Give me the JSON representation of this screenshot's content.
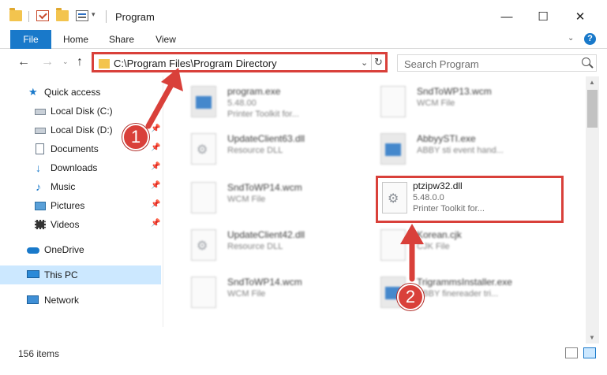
{
  "window": {
    "title": "Program",
    "minimize": "—",
    "maximize": "☐",
    "close": "✕"
  },
  "ribbon": {
    "tabs": [
      "File",
      "Home",
      "Share",
      "View"
    ],
    "help": "?"
  },
  "address": {
    "path": "C:\\Program Files\\Program Directory",
    "dropdown": "⌄",
    "refresh": "↻"
  },
  "search": {
    "placeholder": "Search Program"
  },
  "nav": {
    "back": "←",
    "forward": "→",
    "dropdown": "⌄",
    "up": "↑",
    "items": [
      {
        "label": "Quick access",
        "icon": "star-icon",
        "pinned": false
      },
      {
        "label": "Local Disk (C:)",
        "icon": "disk-icon",
        "pinned": false
      },
      {
        "label": "Local Disk (D:)",
        "icon": "disk-icon",
        "pinned": true
      },
      {
        "label": "Documents",
        "icon": "documents-icon",
        "pinned": true
      },
      {
        "label": "Downloads",
        "icon": "download-icon",
        "pinned": true
      },
      {
        "label": "Music",
        "icon": "music-icon",
        "pinned": true
      },
      {
        "label": "Pictures",
        "icon": "pictures-icon",
        "pinned": true
      },
      {
        "label": "Videos",
        "icon": "videos-icon",
        "pinned": true
      },
      {
        "label": "OneDrive",
        "icon": "cloud-icon",
        "pinned": false
      },
      {
        "label": "This PC",
        "icon": "computer-icon",
        "pinned": false,
        "selected": true
      },
      {
        "label": "Network",
        "icon": "network-icon",
        "pinned": false
      }
    ]
  },
  "files": [
    {
      "name": "program.exe",
      "line1": "5.48.00",
      "line2": "Printer Toolkit for...",
      "icon": "app"
    },
    {
      "name": "SndToWP13.wcm",
      "line1": "WCM File",
      "line2": "",
      "icon": "doc"
    },
    {
      "name": "UpdateClient63.dll",
      "line1": "Resource DLL",
      "line2": "",
      "icon": "gear"
    },
    {
      "name": "AbbyySTI.exe",
      "line1": "ABBY sti event hand...",
      "line2": "",
      "icon": "app"
    },
    {
      "name": "SndToWP14.wcm",
      "line1": "WCM File",
      "line2": "",
      "icon": "doc"
    },
    {
      "name": "ptzipw32.dll",
      "line1": "5.48.0.0",
      "line2": "Printer Toolkit for...",
      "icon": "gear",
      "highlighted": true
    },
    {
      "name": "UpdateClient42.dll",
      "line1": "Resource DLL",
      "line2": "",
      "icon": "gear"
    },
    {
      "name": "Korean.cjk",
      "line1": "CJK File",
      "line2": "",
      "icon": "doc"
    },
    {
      "name": "SndToWP14.wcm",
      "line1": "WCM File",
      "line2": "",
      "icon": "doc"
    },
    {
      "name": "TrigrammsInstaller.exe",
      "line1": "ABBY finereader tri...",
      "line2": "",
      "icon": "app"
    }
  ],
  "status": {
    "count": "156 items"
  },
  "annotations": {
    "step1": "1",
    "step2": "2",
    "color": "#d9403a"
  }
}
